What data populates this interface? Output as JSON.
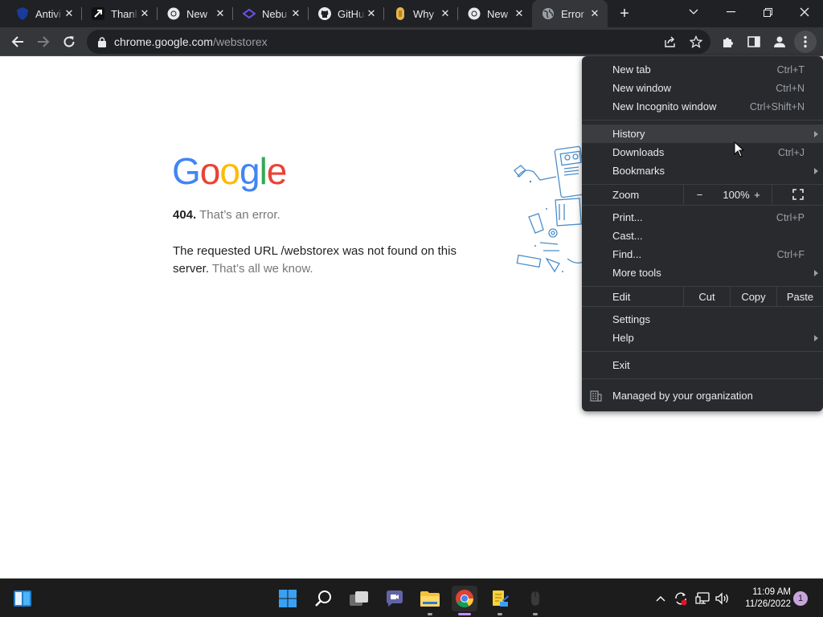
{
  "tabs": [
    {
      "title": "Antivi",
      "icon": "shield-icon"
    },
    {
      "title": "Thanl",
      "icon": "arrow-logo-icon"
    },
    {
      "title": "New",
      "icon": "chrome-icon"
    },
    {
      "title": "Nebu",
      "icon": "nebula-icon"
    },
    {
      "title": "GitHu",
      "icon": "github-icon"
    },
    {
      "title": "Why",
      "icon": "bookmark-gold-icon"
    },
    {
      "title": "New",
      "icon": "chrome-icon"
    },
    {
      "title": "Error",
      "icon": "globe-icon",
      "active": true
    }
  ],
  "address_bar": {
    "host": "chrome.google.com",
    "path": "/webstorex"
  },
  "error_page": {
    "logo": [
      "G",
      "o",
      "o",
      "g",
      "l",
      "e"
    ],
    "logo_colors": [
      "#4285f4",
      "#ea4335",
      "#fbbc05",
      "#4285f4",
      "#34a853",
      "#ea4335"
    ],
    "code": "404.",
    "code_message": "That’s an error.",
    "detail": "The requested URL /webstorex was not found on this server.",
    "detail_suffix": "That’s all we know."
  },
  "menu": {
    "new_tab": {
      "label": "New tab",
      "shortcut": "Ctrl+T"
    },
    "new_window": {
      "label": "New window",
      "shortcut": "Ctrl+N"
    },
    "incognito": {
      "label": "New Incognito window",
      "shortcut": "Ctrl+Shift+N"
    },
    "history": {
      "label": "History"
    },
    "downloads": {
      "label": "Downloads",
      "shortcut": "Ctrl+J"
    },
    "bookmarks": {
      "label": "Bookmarks"
    },
    "zoom": {
      "label": "Zoom",
      "minus": "−",
      "value": "100%",
      "plus": "+"
    },
    "print": {
      "label": "Print...",
      "shortcut": "Ctrl+P"
    },
    "cast": {
      "label": "Cast..."
    },
    "find": {
      "label": "Find...",
      "shortcut": "Ctrl+F"
    },
    "more_tools": {
      "label": "More tools"
    },
    "edit": {
      "label": "Edit",
      "cut": "Cut",
      "copy": "Copy",
      "paste": "Paste"
    },
    "settings": {
      "label": "Settings"
    },
    "help": {
      "label": "Help"
    },
    "exit": {
      "label": "Exit"
    },
    "managed": {
      "label": "Managed by your organization"
    }
  },
  "taskbar": {
    "time": "11:09 AM",
    "date": "11/26/2022",
    "notifications": "1"
  },
  "colors": {
    "tabstrip_bg": "#202124",
    "toolbar_bg": "#35363a",
    "menu_bg": "#292a2d",
    "taskbar_bg": "#1c1c1c"
  }
}
